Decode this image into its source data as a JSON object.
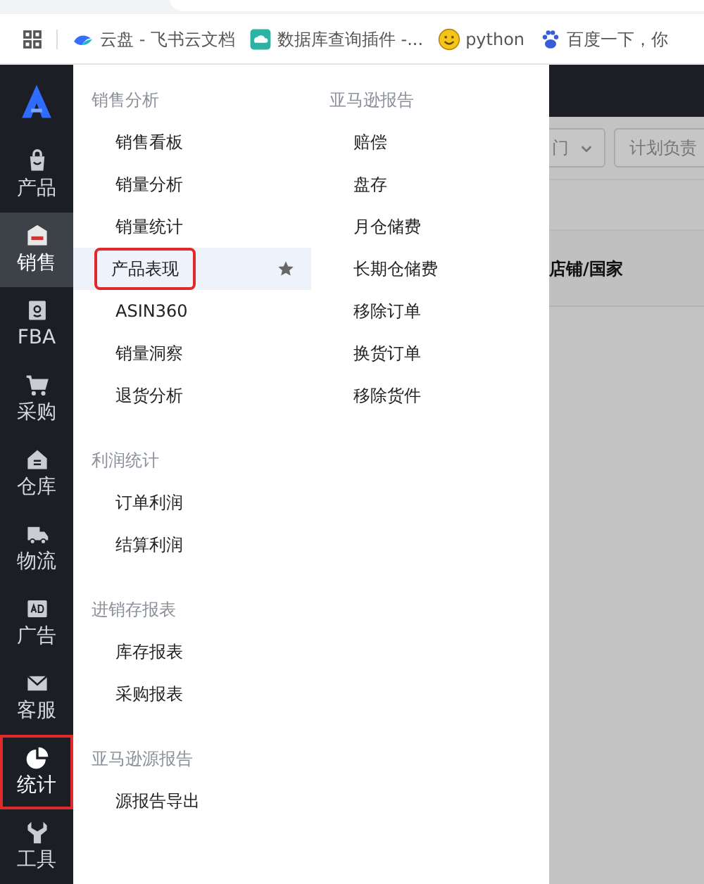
{
  "bookmarks": [
    {
      "kind": "cloud",
      "label": "云盘 - 飞书云文档"
    },
    {
      "kind": "db",
      "label": "数据库查询插件 -..."
    },
    {
      "kind": "smile",
      "label": "python"
    },
    {
      "kind": "paw",
      "label": "百度一下，你"
    }
  ],
  "sidebar": {
    "items": [
      {
        "kind": "bag",
        "label": "产品",
        "selected": false,
        "outlined": false
      },
      {
        "kind": "sel",
        "label": "销售",
        "selected": true,
        "outlined": false
      },
      {
        "kind": "amazon",
        "label": "FBA",
        "selected": false,
        "outlined": false
      },
      {
        "kind": "cart",
        "label": "采购",
        "selected": false,
        "outlined": false
      },
      {
        "kind": "house",
        "label": "仓库",
        "selected": false,
        "outlined": false
      },
      {
        "kind": "truck",
        "label": "物流",
        "selected": false,
        "outlined": false
      },
      {
        "kind": "ad",
        "label": "广告",
        "selected": false,
        "outlined": false
      },
      {
        "kind": "mail",
        "label": "客服",
        "selected": false,
        "outlined": false
      },
      {
        "kind": "pie",
        "label": "统计",
        "selected": false,
        "outlined": true
      },
      {
        "kind": "wrench",
        "label": "工具",
        "selected": false,
        "outlined": false
      }
    ]
  },
  "menu": {
    "columns": [
      {
        "groups": [
          {
            "title": "销售分析",
            "items": [
              {
                "label": "销售看板",
                "selected": false,
                "starred": false,
                "outlined": false
              },
              {
                "label": "销量分析",
                "selected": false,
                "starred": false,
                "outlined": false
              },
              {
                "label": "销量统计",
                "selected": false,
                "starred": false,
                "outlined": false
              },
              {
                "label": "产品表现",
                "selected": true,
                "starred": true,
                "outlined": true
              },
              {
                "label": "ASIN360",
                "selected": false,
                "starred": false,
                "outlined": false
              },
              {
                "label": "销量洞察",
                "selected": false,
                "starred": false,
                "outlined": false
              },
              {
                "label": "退货分析",
                "selected": false,
                "starred": false,
                "outlined": false
              }
            ]
          },
          {
            "title": "利润统计",
            "items": [
              {
                "label": "订单利润",
                "selected": false,
                "starred": false,
                "outlined": false
              },
              {
                "label": "结算利润",
                "selected": false,
                "starred": false,
                "outlined": false
              }
            ]
          },
          {
            "title": "进销存报表",
            "items": [
              {
                "label": "库存报表",
                "selected": false,
                "starred": false,
                "outlined": false
              },
              {
                "label": "采购报表",
                "selected": false,
                "starred": false,
                "outlined": false
              }
            ]
          },
          {
            "title": "亚马逊源报告",
            "items": [
              {
                "label": "源报告导出",
                "selected": false,
                "starred": false,
                "outlined": false
              }
            ]
          }
        ]
      },
      {
        "groups": [
          {
            "title": "亚马逊报告",
            "items": [
              {
                "label": "赔偿",
                "selected": false,
                "starred": false,
                "outlined": false
              },
              {
                "label": "盘存",
                "selected": false,
                "starred": false,
                "outlined": false
              },
              {
                "label": "月仓储费",
                "selected": false,
                "starred": false,
                "outlined": false
              },
              {
                "label": "长期仓储费",
                "selected": false,
                "starred": false,
                "outlined": false
              },
              {
                "label": "移除订单",
                "selected": false,
                "starred": false,
                "outlined": false
              },
              {
                "label": "换货订单",
                "selected": false,
                "starred": false,
                "outlined": false
              },
              {
                "label": "移除货件",
                "selected": false,
                "starred": false,
                "outlined": false
              }
            ]
          }
        ]
      }
    ]
  },
  "background": {
    "filters": [
      {
        "kind": "select",
        "value": "门"
      },
      {
        "kind": "input",
        "placeholder": "计划负责"
      }
    ],
    "table": {
      "columns": [
        "店铺/国家"
      ]
    }
  }
}
